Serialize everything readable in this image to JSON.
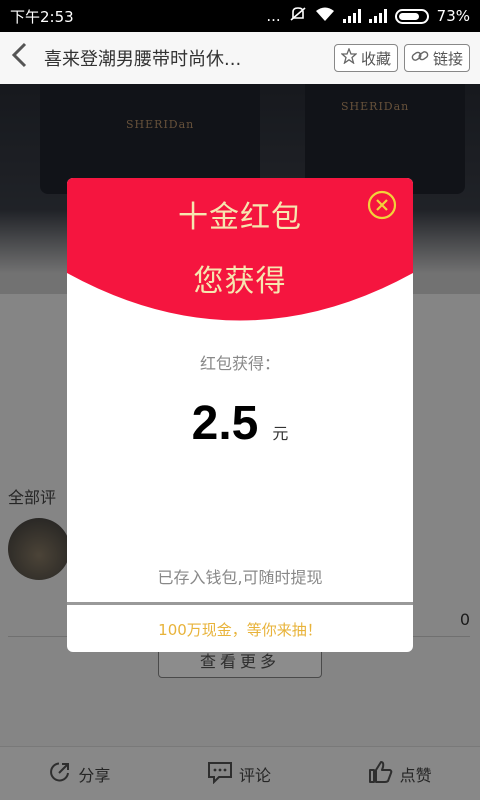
{
  "status_bar": {
    "time": "下午2:53",
    "dots": "...",
    "battery_text": "73%"
  },
  "nav": {
    "title": "喜来登潮男腰带时尚休...",
    "favorite_label": "收藏",
    "link_label": "链接"
  },
  "hero": {
    "brand_left": "SHERIDan",
    "brand_right": "SHERIDan"
  },
  "content": {
    "section_label": "全部评",
    "like_count": "0",
    "more_label": "查看更多"
  },
  "bottom_bar": {
    "share_label": "分享",
    "comment_label": "评论",
    "like_label": "点赞"
  },
  "modal": {
    "title": "十金红包",
    "subtitle": "您获得",
    "got_label": "红包获得：",
    "amount": "2.5",
    "unit": "元",
    "saved_note": "已存入钱包,可随时提现",
    "promo": "100万现金，等你来抽！"
  },
  "colors": {
    "modal_red": "#f5153f",
    "gold_text": "#f6e6b0",
    "promo_text": "#e8b33a",
    "close_icon": "#f2d23a"
  }
}
